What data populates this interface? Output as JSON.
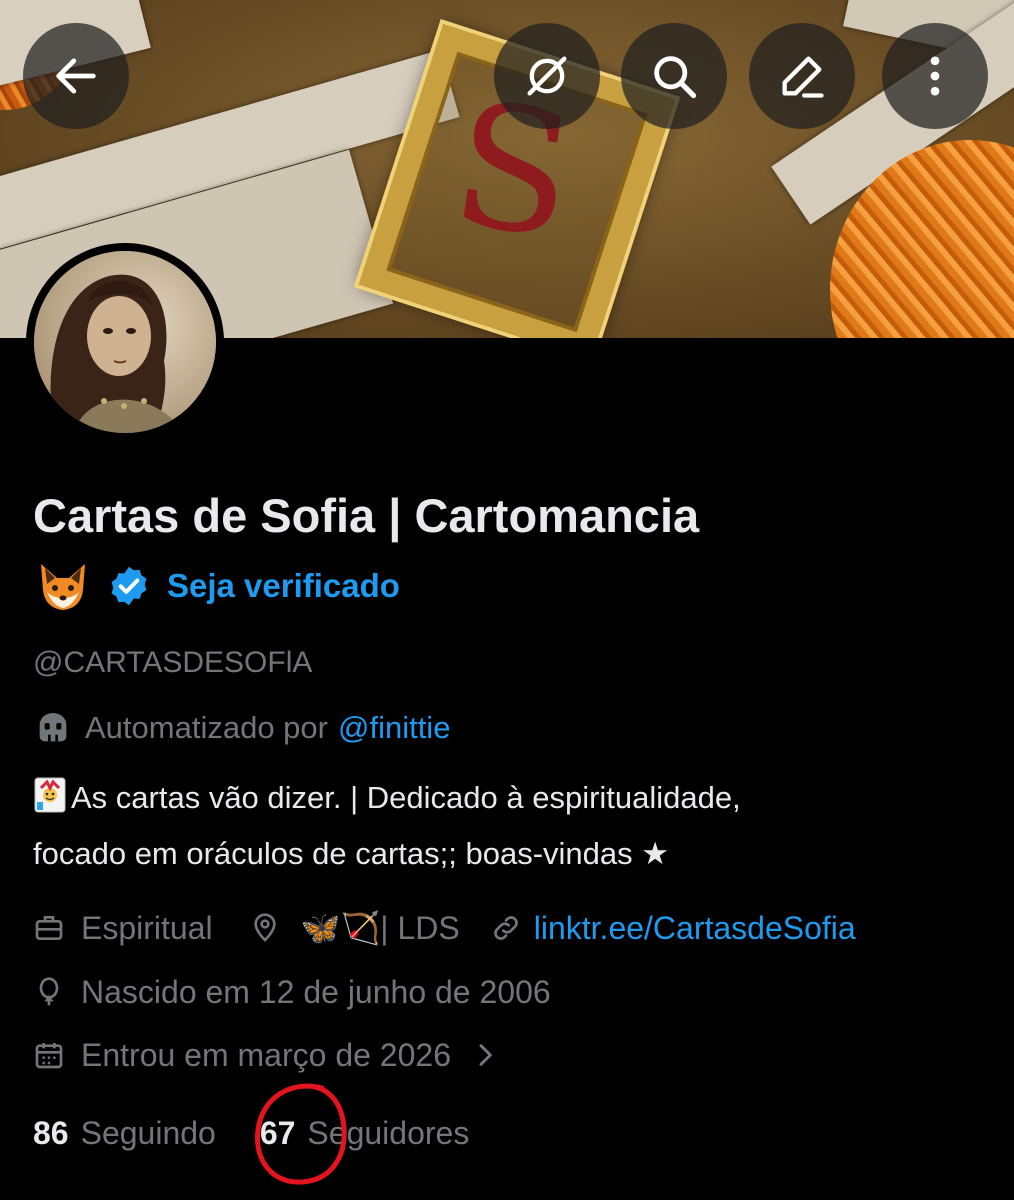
{
  "header": {
    "back_icon": "arrow-left-icon",
    "grok_icon": "grok-icon",
    "search_icon": "search-icon",
    "edit_icon": "pencil-icon",
    "more_icon": "more-vertical-icon"
  },
  "banner": {
    "letter": "S"
  },
  "profile": {
    "display_name": "Cartas de Sofia | Cartomancia",
    "name_emoji_icon": "fox-face-icon",
    "verified_icon": "verified-badge-icon",
    "verify_cta": "Seja verificado",
    "handle": "@CARTASDESOFlA",
    "automated_icon": "bot-icon",
    "automated_prefix": "Automatizado por",
    "automated_by": "@finittie",
    "bio_line1": "As cartas vão dizer. | Dedicado à espiritualidade,",
    "bio_line2": "focado em oráculos de cartas;; boas-vindas ★",
    "bio_emoji_icon": "joker-card-icon"
  },
  "meta": {
    "category": "Espiritual",
    "location_emojis": "🦋🏹",
    "location_text": "| LDS",
    "link": "linktr.ee/CartasdeSofia",
    "birth": "Nascido em 12 de junho de 2006",
    "joined": "Entrou em março de 2026",
    "icons": [
      "briefcase-icon",
      "location-pin-icon",
      "link-icon",
      "balloon-icon",
      "calendar-icon",
      "chevron-right-icon"
    ]
  },
  "stats": {
    "following_count": "86",
    "following_label": "Seguindo",
    "followers_count": "67",
    "followers_label": "Seguidores"
  },
  "colors": {
    "background": "#000000",
    "text": "#e7e9ea",
    "muted": "#71767b",
    "accent": "#1d9bf0",
    "annotation": "#e3141e"
  }
}
